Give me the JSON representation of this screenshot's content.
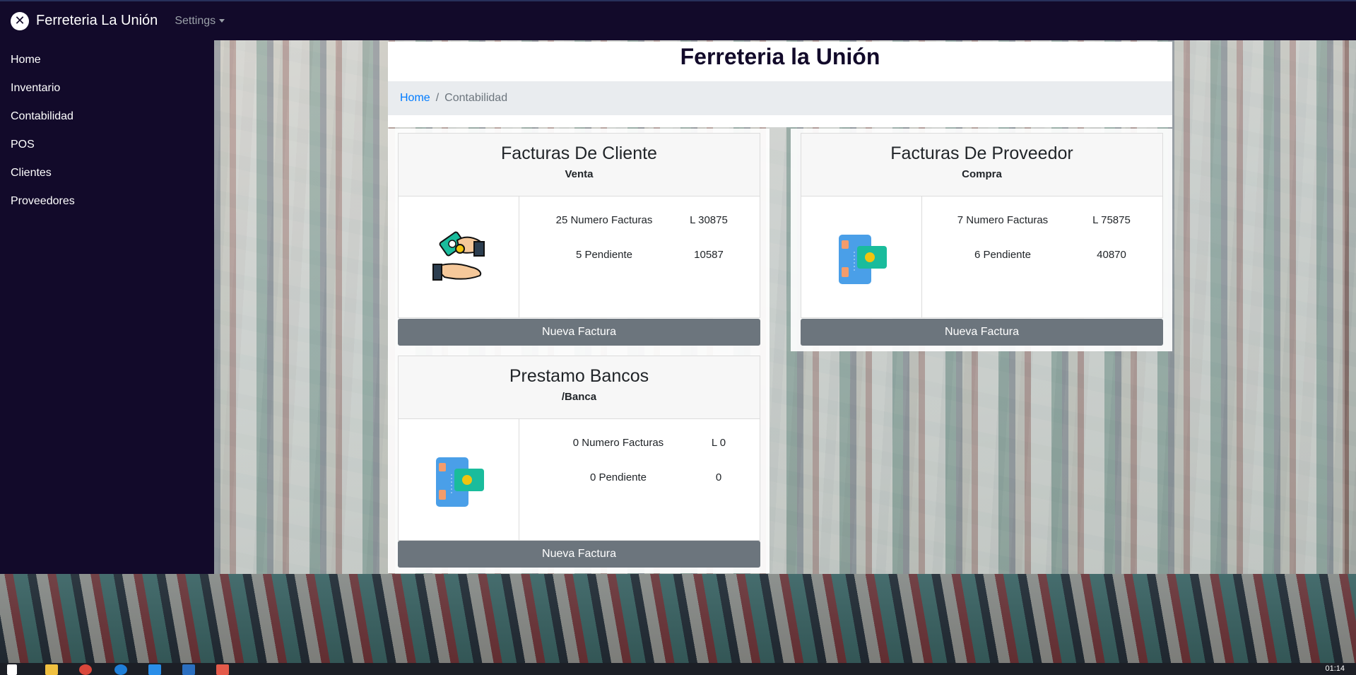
{
  "navbar": {
    "brand": "Ferreteria La Unión",
    "settings_label": "Settings"
  },
  "sidebar": {
    "items": [
      {
        "label": "Home"
      },
      {
        "label": "Inventario"
      },
      {
        "label": "Contabilidad"
      },
      {
        "label": "POS"
      },
      {
        "label": "Clientes"
      },
      {
        "label": "Proveedores"
      }
    ]
  },
  "header": {
    "title": "Ferreteria la Unión",
    "breadcrumb": {
      "home": "Home",
      "separator": "/",
      "current": "Contabilidad"
    }
  },
  "cards": [
    {
      "title": "Facturas De Cliente",
      "subtitle": "Venta",
      "icon": "hand-money-icon",
      "count_label": "25 Numero Facturas",
      "count_value": "L 30875",
      "pending_label": "5 Pendiente",
      "pending_value": "10587",
      "button": "Nueva Factura"
    },
    {
      "title": "Facturas De Proveedor",
      "subtitle": "Compra",
      "icon": "credit-card-icon",
      "count_label": "7 Numero Facturas",
      "count_value": "L 75875",
      "pending_label": "6 Pendiente",
      "pending_value": "40870",
      "button": "Nueva Factura"
    },
    {
      "title": "Prestamo Bancos",
      "subtitle": "/Banca",
      "icon": "credit-card-icon",
      "count_label": "0 Numero Facturas",
      "count_value": "L 0",
      "pending_label": "0 Pendiente",
      "pending_value": "0",
      "button": "Nueva Factura"
    }
  ],
  "taskbar": {
    "clock": "01:14"
  },
  "colors": {
    "nav_bg": "#120a2a",
    "button_bg": "#6c757d",
    "link": "#007bff",
    "breadcrumb_bg": "#e9ecef"
  }
}
